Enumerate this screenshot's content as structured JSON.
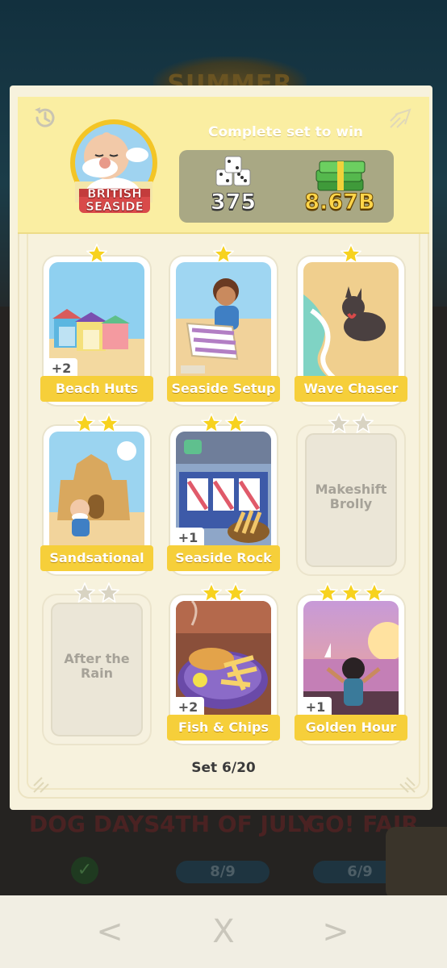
{
  "background": {
    "banner_text": "SUMMER",
    "events": [
      "DOG DAYS",
      "4TH OF JULY",
      "GO! FAIR"
    ],
    "progress": [
      "8/9",
      "6/9"
    ]
  },
  "album": {
    "set_name": "BRITISH SEASIDE",
    "reward_title": "Complete set to win",
    "rewards": {
      "dice": "375",
      "cash": "8.67B"
    },
    "set_count": "Set 6/20",
    "cards": [
      {
        "name": "Beach Huts",
        "stars": 1,
        "badge": "+2",
        "collected": true
      },
      {
        "name": "Seaside Setup",
        "stars": 1,
        "badge": "",
        "collected": true
      },
      {
        "name": "Wave Chaser",
        "stars": 1,
        "badge": "",
        "collected": true
      },
      {
        "name": "Sandsational",
        "stars": 2,
        "badge": "",
        "collected": true
      },
      {
        "name": "Seaside Rock",
        "stars": 2,
        "badge": "+1",
        "collected": true
      },
      {
        "name": "Makeshift Brolly",
        "stars": 2,
        "badge": "",
        "collected": false
      },
      {
        "name": "After the Rain",
        "stars": 2,
        "badge": "",
        "collected": false
      },
      {
        "name": "Fish & Chips",
        "stars": 2,
        "badge": "+2",
        "collected": true
      },
      {
        "name": "Golden Hour",
        "stars": 3,
        "badge": "+1",
        "collected": true
      }
    ]
  },
  "nav": {
    "prev": "<",
    "close": "X",
    "next": ">"
  },
  "colors": {
    "label": "#f6cf3a",
    "header": "#faeea2",
    "panel": "#f7f2dd",
    "star": "#f7d21f"
  }
}
